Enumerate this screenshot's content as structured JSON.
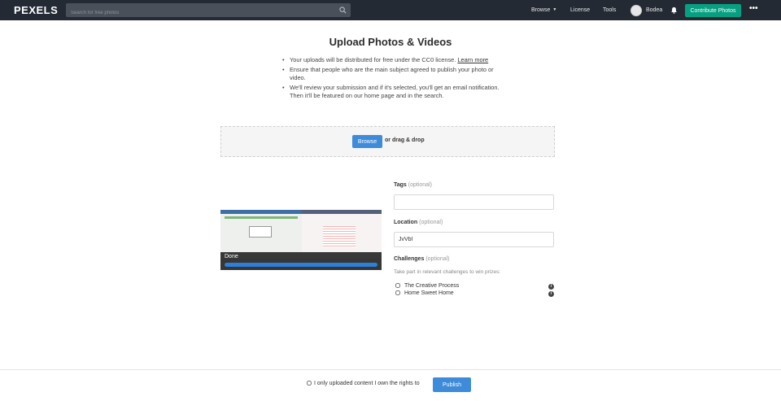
{
  "header": {
    "logo": "PEXELS",
    "search_placeholder": "Search for free photos",
    "nav": {
      "browse": "Browse",
      "license": "License",
      "tools": "Tools",
      "user_name": "Bodea"
    },
    "contribute_label": "Contribute Photos",
    "more_label": "•••"
  },
  "main": {
    "title": "Upload Photos & Videos",
    "guidelines": [
      {
        "text": "Your uploads will be distributed for free under the CC0 license. ",
        "link": "Learn more"
      },
      {
        "text": "Ensure that people who are the main subject agreed to publish your photo or video."
      },
      {
        "text": "We'll review your submission and if it's selected, you'll get an email notification. Then it'll be featured on our home page and in the search."
      }
    ],
    "dropzone": {
      "browse_label": "Browse",
      "drag_text": "or drag & drop"
    },
    "preview": {
      "status": "Done",
      "progress": 1.0
    },
    "form": {
      "tags_label": "Tags",
      "tags_optional": "(optional)",
      "tags_value": "",
      "location_label": "Location",
      "location_optional": "(optional)",
      "location_value": "JvVbI",
      "challenges_label": "Challenges",
      "challenges_optional": "(optional)",
      "challenges_help": "Take part in relevant challenges to win prizes:",
      "challenges": [
        {
          "label": "The Creative Process",
          "checked": false
        },
        {
          "label": "Home Sweet Home",
          "checked": false
        }
      ]
    }
  },
  "footer": {
    "rights_label": "I only uploaded content I own the rights to",
    "rights_checked": false,
    "publish_label": "Publish"
  },
  "colors": {
    "topbar": "#232a34",
    "contribute": "#05a081",
    "primary_button": "#3e8bd9"
  }
}
